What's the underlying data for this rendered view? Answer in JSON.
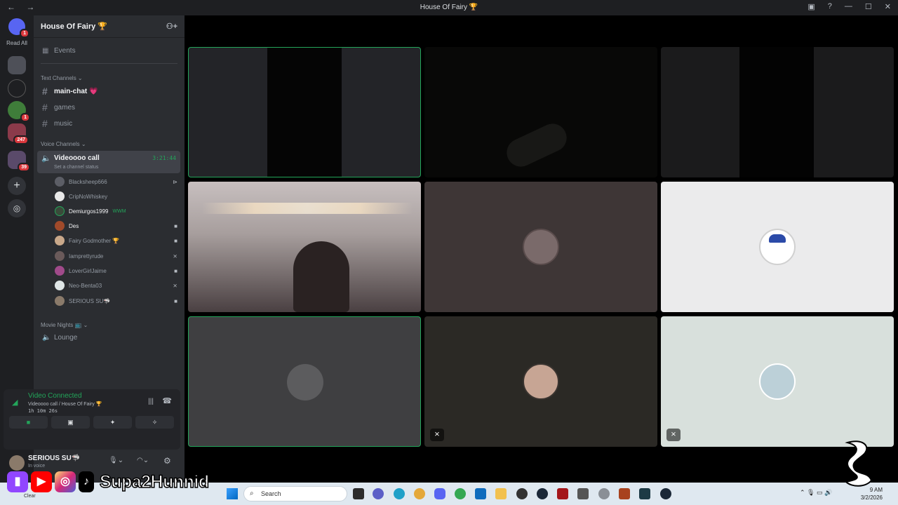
{
  "window": {
    "title": "House Of Fairy 🏆"
  },
  "servers": {
    "read_all": "Read All",
    "badges": [
      "1",
      "1",
      "247",
      "39"
    ]
  },
  "guild": {
    "name": "House Of Fairy 🏆"
  },
  "events_label": "Events",
  "text_category": "Text Channels",
  "text_channels": [
    "main-chat 💗",
    "games",
    "music"
  ],
  "voice_category": "Voice Channels",
  "active_voice": {
    "name": "Videoooo call",
    "timer": "3:21:44",
    "status": "Set a channel status"
  },
  "voice_users": [
    {
      "name": "Blacksheep666",
      "icon": "playstation-icon"
    },
    {
      "name": "CripNoWhiskey",
      "icon": ""
    },
    {
      "name": "Demiurgos1999",
      "tag": "WWM",
      "icon": ""
    },
    {
      "name": "Des",
      "icon": "camera-icon"
    },
    {
      "name": "Fairy Godmother 🏆",
      "icon": "camera-icon"
    },
    {
      "name": "Iamprettyrude",
      "icon": "mic-muted-icon"
    },
    {
      "name": "LoverGirlJaime",
      "icon": "camera-icon"
    },
    {
      "name": "Neo-Benta03",
      "icon": "mic-muted-icon"
    },
    {
      "name": "SERIOUS SU🦈",
      "icon": "camera-icon"
    }
  ],
  "movie_category": "Movie Nights 📺",
  "lounge": "Lounge",
  "connection": {
    "status": "Video Connected",
    "channel": "Videoooo call / House Of Fairy 🏆",
    "elapsed": "1h 10m 26s"
  },
  "user": {
    "name": "SERIOUS SU🦈",
    "status": "In voice"
  },
  "taskbar": {
    "search_placeholder": "Search",
    "time": "9 AM",
    "date": "3/2/2026",
    "clear": "Clear"
  },
  "overlay": {
    "name": "Supa2Hunnid"
  },
  "colors": {
    "accent_green": "#23a55a",
    "sidebar": "#2b2d31",
    "rail": "#1e1f22",
    "badge_red": "#da373c"
  }
}
